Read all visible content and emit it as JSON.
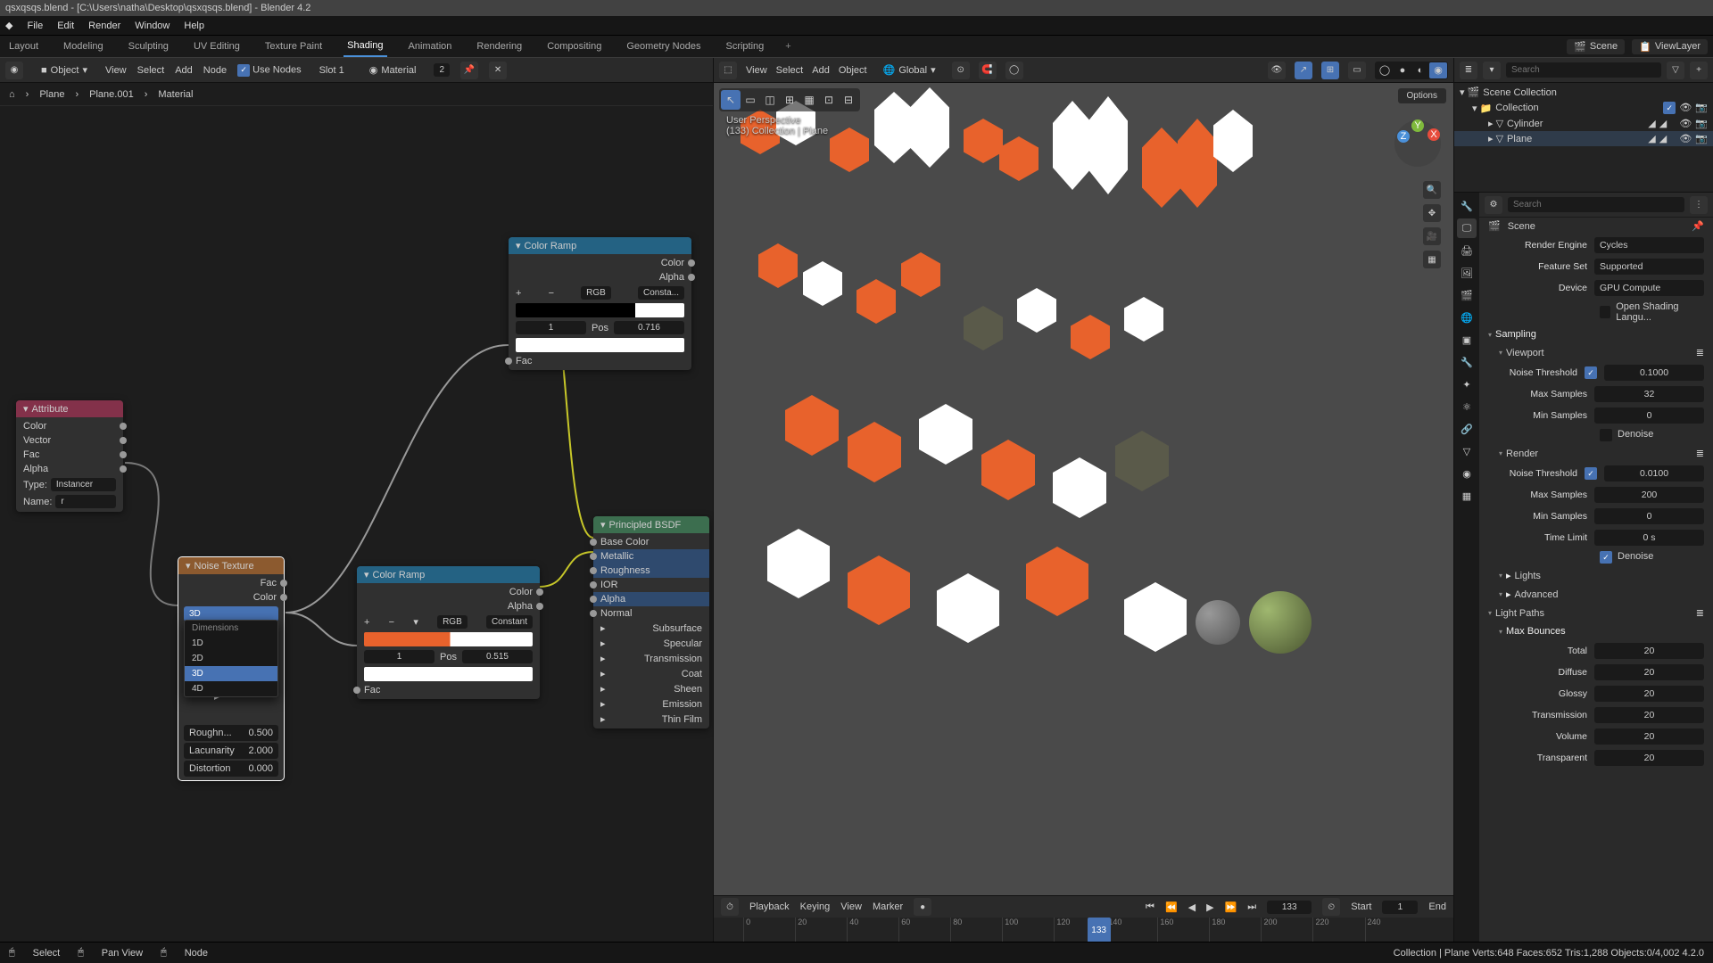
{
  "title": "qsxqsqs.blend - [C:\\Users\\natha\\Desktop\\qsxqsqs.blend] - Blender 4.2",
  "menu": [
    "File",
    "Edit",
    "Render",
    "Window",
    "Help"
  ],
  "tabs": [
    "Layout",
    "Modeling",
    "Sculpting",
    "UV Editing",
    "Texture Paint",
    "Shading",
    "Animation",
    "Rendering",
    "Compositing",
    "Geometry Nodes",
    "Scripting"
  ],
  "active_tab": "Shading",
  "scene": "Scene",
  "viewlayer": "ViewLayer",
  "ne": {
    "mode": "Object",
    "menus": [
      "View",
      "Select",
      "Add",
      "Node"
    ],
    "use_nodes": "Use Nodes",
    "slot": "Slot 1",
    "material": "Material",
    "users": "2",
    "crumb": [
      "Plane",
      "Plane.001",
      "Material"
    ],
    "attribute": {
      "title": "Attribute",
      "out": [
        "Color",
        "Vector",
        "Fac",
        "Alpha"
      ],
      "type_lbl": "Type:",
      "type": "Instancer",
      "name_lbl": "Name:",
      "name": "r"
    },
    "noise": {
      "title": "Noise Texture",
      "out": [
        "Fac",
        "Color"
      ],
      "dim": "3D",
      "dims_label": "Dimensions",
      "options": [
        "1D",
        "2D",
        "3D",
        "4D"
      ],
      "fields": [
        [
          "Roughn...",
          "0.500"
        ],
        [
          "Lacunarity",
          "2.000"
        ],
        [
          "Distortion",
          "0.000"
        ]
      ]
    },
    "ramp1": {
      "title": "Color Ramp",
      "out": [
        "Color",
        "Alpha"
      ],
      "interp": "RGB",
      "mode": "Constant",
      "idx": "1",
      "pos_lbl": "Pos",
      "pos": "0.515",
      "fac": "Fac"
    },
    "ramp2": {
      "title": "Color Ramp",
      "out": [
        "Color",
        "Alpha"
      ],
      "interp": "RGB",
      "mode": "Consta...",
      "idx": "1",
      "pos_lbl": "Pos",
      "pos": "0.716",
      "fac": "Fac"
    },
    "bsdf": {
      "title": "Principled BSDF",
      "highlighted": [
        "Metallic",
        "Roughness",
        "Alpha"
      ],
      "inputs": [
        "Base Color",
        "Metallic",
        "Roughness",
        "IOR",
        "Alpha",
        "Normal"
      ],
      "groups": [
        "Subsurface",
        "Specular",
        "Transmission",
        "Coat",
        "Sheen",
        "Emission",
        "Thin Film"
      ]
    }
  },
  "vp": {
    "menus": [
      "View",
      "Select",
      "Add",
      "Object"
    ],
    "orient": "Global",
    "persp": "User Perspective",
    "info": "(133) Collection | Plane",
    "options": "Options"
  },
  "tl": {
    "menus": [
      "Playback",
      "Keying",
      "View",
      "Marker"
    ],
    "frame": "133",
    "start_lbl": "Start",
    "start": "1",
    "end_lbl": "End",
    "end": "",
    "ticks": [
      "0",
      "20",
      "40",
      "60",
      "80",
      "100",
      "120",
      "140",
      "160",
      "180",
      "200",
      "220",
      "240"
    ]
  },
  "outliner": {
    "search": "Search",
    "items": [
      {
        "name": "Scene Collection",
        "depth": 0,
        "type": "scene"
      },
      {
        "name": "Collection",
        "depth": 1,
        "type": "coll",
        "sel": false
      },
      {
        "name": "Cylinder",
        "depth": 2,
        "type": "mesh"
      },
      {
        "name": "Plane",
        "depth": 2,
        "type": "mesh",
        "sel": true
      }
    ]
  },
  "props": {
    "search": "Search",
    "scene": "Scene",
    "render_engine_lbl": "Render Engine",
    "render_engine": "Cycles",
    "feature_lbl": "Feature Set",
    "feature": "Supported",
    "device_lbl": "Device",
    "device": "GPU Compute",
    "osl": "Open Shading Langu...",
    "sampling": "Sampling",
    "viewport": "Viewport",
    "render": "Render",
    "noise_thr_lbl": "Noise Threshold",
    "vp_noise": "0.1000",
    "vp_max": "32",
    "vp_min": "0",
    "max_s_lbl": "Max Samples",
    "min_s_lbl": "Min Samples",
    "denoise": "Denoise",
    "rd_noise": "0.0100",
    "rd_max": "200",
    "rd_min": "0",
    "time_lbl": "Time Limit",
    "time": "0 s",
    "lights": "Lights",
    "advanced": "Advanced",
    "lightpaths": "Light Paths",
    "maxb": "Max Bounces",
    "bounces": [
      [
        "Total",
        "20"
      ],
      [
        "Diffuse",
        "20"
      ],
      [
        "Glossy",
        "20"
      ],
      [
        "Transmission",
        "20"
      ],
      [
        "Volume",
        "20"
      ],
      [
        "Transparent",
        "20"
      ]
    ]
  },
  "status": {
    "select": "Select",
    "pan": "Pan View",
    "node": "Node",
    "right": "Collection | Plane   Verts:648   Faces:652   Tris:1,288   Objects:0/4,002   4.2.0"
  }
}
